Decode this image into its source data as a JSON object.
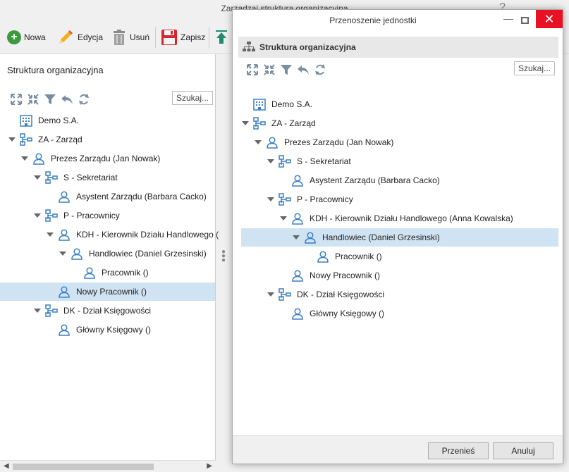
{
  "main_window": {
    "title": "Zarządzaj struktura organizacyjna",
    "help": "?",
    "toolbar": {
      "new_label": "Nowa",
      "edit_label": "Edycja",
      "delete_label": "Usuń",
      "save_label": "Zapisz"
    },
    "panel_title": "Struktura organizacyjna",
    "search_label": "Szukaj...",
    "tree": [
      {
        "label": "Demo S.A.",
        "icon": "building-icon",
        "level": 0,
        "expanded": false,
        "has_children": false
      },
      {
        "label": "ZA - Zarząd",
        "icon": "org-unit-icon",
        "level": 0,
        "expanded": true,
        "has_children": true
      },
      {
        "label": "Prezes Zarządu (Jan Nowak)",
        "icon": "person-icon",
        "level": 1,
        "expanded": true,
        "has_children": true
      },
      {
        "label": "S - Sekretariat",
        "icon": "org-unit-icon",
        "level": 2,
        "expanded": true,
        "has_children": true
      },
      {
        "label": "Asystent Zarządu (Barbara Cacko)",
        "icon": "person-icon",
        "level": 3,
        "expanded": false,
        "has_children": false
      },
      {
        "label": "P - Pracownicy",
        "icon": "org-unit-icon",
        "level": 2,
        "expanded": true,
        "has_children": true
      },
      {
        "label": "KDH - Kierownik Działu Handlowego (",
        "icon": "person-icon",
        "level": 3,
        "expanded": true,
        "has_children": true
      },
      {
        "label": "Handlowiec (Daniel Grzesinski)",
        "icon": "person-icon",
        "level": 4,
        "expanded": true,
        "has_children": true
      },
      {
        "label": "Pracownik ()",
        "icon": "person-icon",
        "level": 5,
        "expanded": false,
        "has_children": false
      },
      {
        "label": "Nowy Pracownik ()",
        "icon": "person-icon",
        "level": 3,
        "expanded": false,
        "has_children": false,
        "selected": true
      },
      {
        "label": "DK - Dział Księgowości",
        "icon": "org-unit-icon",
        "level": 2,
        "expanded": true,
        "has_children": true
      },
      {
        "label": "Główny Księgowy ()",
        "icon": "person-icon",
        "level": 3,
        "expanded": false,
        "has_children": false
      }
    ]
  },
  "dialog": {
    "title": "Przenoszenie jednostki",
    "header": "Struktura organizacyjna",
    "search_label": "Szukaj...",
    "tree": [
      {
        "label": "Demo S.A.",
        "icon": "building-icon",
        "level": 0,
        "expanded": false,
        "has_children": false
      },
      {
        "label": "ZA - Zarząd",
        "icon": "org-unit-icon",
        "level": 0,
        "expanded": true,
        "has_children": true
      },
      {
        "label": "Prezes Zarządu (Jan Nowak)",
        "icon": "person-icon",
        "level": 1,
        "expanded": true,
        "has_children": true
      },
      {
        "label": "S - Sekretariat",
        "icon": "org-unit-icon",
        "level": 2,
        "expanded": true,
        "has_children": true
      },
      {
        "label": "Asystent Zarządu (Barbara Cacko)",
        "icon": "person-icon",
        "level": 3,
        "expanded": false,
        "has_children": false
      },
      {
        "label": "P - Pracownicy",
        "icon": "org-unit-icon",
        "level": 2,
        "expanded": true,
        "has_children": true
      },
      {
        "label": "KDH - Kierownik Działu Handlowego (Anna Kowalska)",
        "icon": "person-icon",
        "level": 3,
        "expanded": true,
        "has_children": true
      },
      {
        "label": "Handlowiec (Daniel Grzesinski)",
        "icon": "person-icon",
        "level": 4,
        "expanded": true,
        "has_children": true,
        "selected": true
      },
      {
        "label": "Pracownik ()",
        "icon": "person-icon",
        "level": 5,
        "expanded": false,
        "has_children": false
      },
      {
        "label": "Nowy Pracownik ()",
        "icon": "person-icon",
        "level": 3,
        "expanded": false,
        "has_children": false
      },
      {
        "label": "DK - Dział Księgowości",
        "icon": "org-unit-icon",
        "level": 2,
        "expanded": true,
        "has_children": true
      },
      {
        "label": "Główny Księgowy ()",
        "icon": "person-icon",
        "level": 3,
        "expanded": false,
        "has_children": false
      }
    ],
    "move_label": "Przenieś",
    "cancel_label": "Anuluj"
  },
  "colors": {
    "selection": "#cfe3f3",
    "icon_blue": "#3b7fc4",
    "close_red": "#e81123"
  }
}
